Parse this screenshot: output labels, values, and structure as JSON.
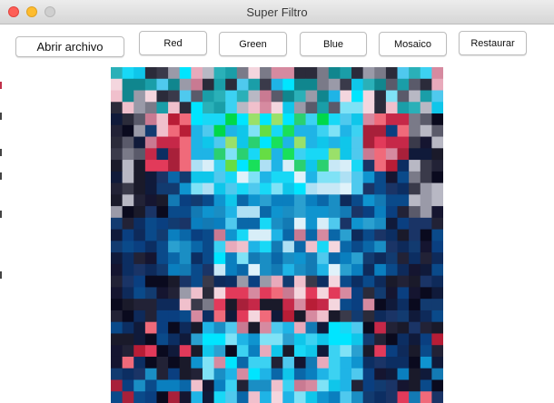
{
  "window": {
    "title": "Super Filtro"
  },
  "toolbar": {
    "open_file_label": "Abrir archivo",
    "red_label": "Red",
    "green_label": "Green",
    "blue_label": "Blue",
    "mosaic_label": "Mosaico",
    "restore_label": "Restaurar"
  },
  "image": {
    "description_icon": "pixelated-mosaic-image",
    "palette": [
      "#0a0a1e",
      "#101a3a",
      "#0e2a5a",
      "#0a3f80",
      "#0a67a8",
      "#0f94cf",
      "#1fb4e6",
      "#3cd2f2",
      "#00e5ff",
      "#8fdcf2",
      "#c8e8f6",
      "#f0c0cc",
      "#e23a5a",
      "#b81d36",
      "#5a1a2e",
      "#2b2b3a",
      "#5a5a6a",
      "#9a9aa8",
      "#00d84a",
      "#66dd44",
      "#1a9ea8",
      "#d96a6a",
      "#3a3a4a",
      "#7a2a3a"
    ],
    "colors_note_accent": "#00c8f0"
  }
}
